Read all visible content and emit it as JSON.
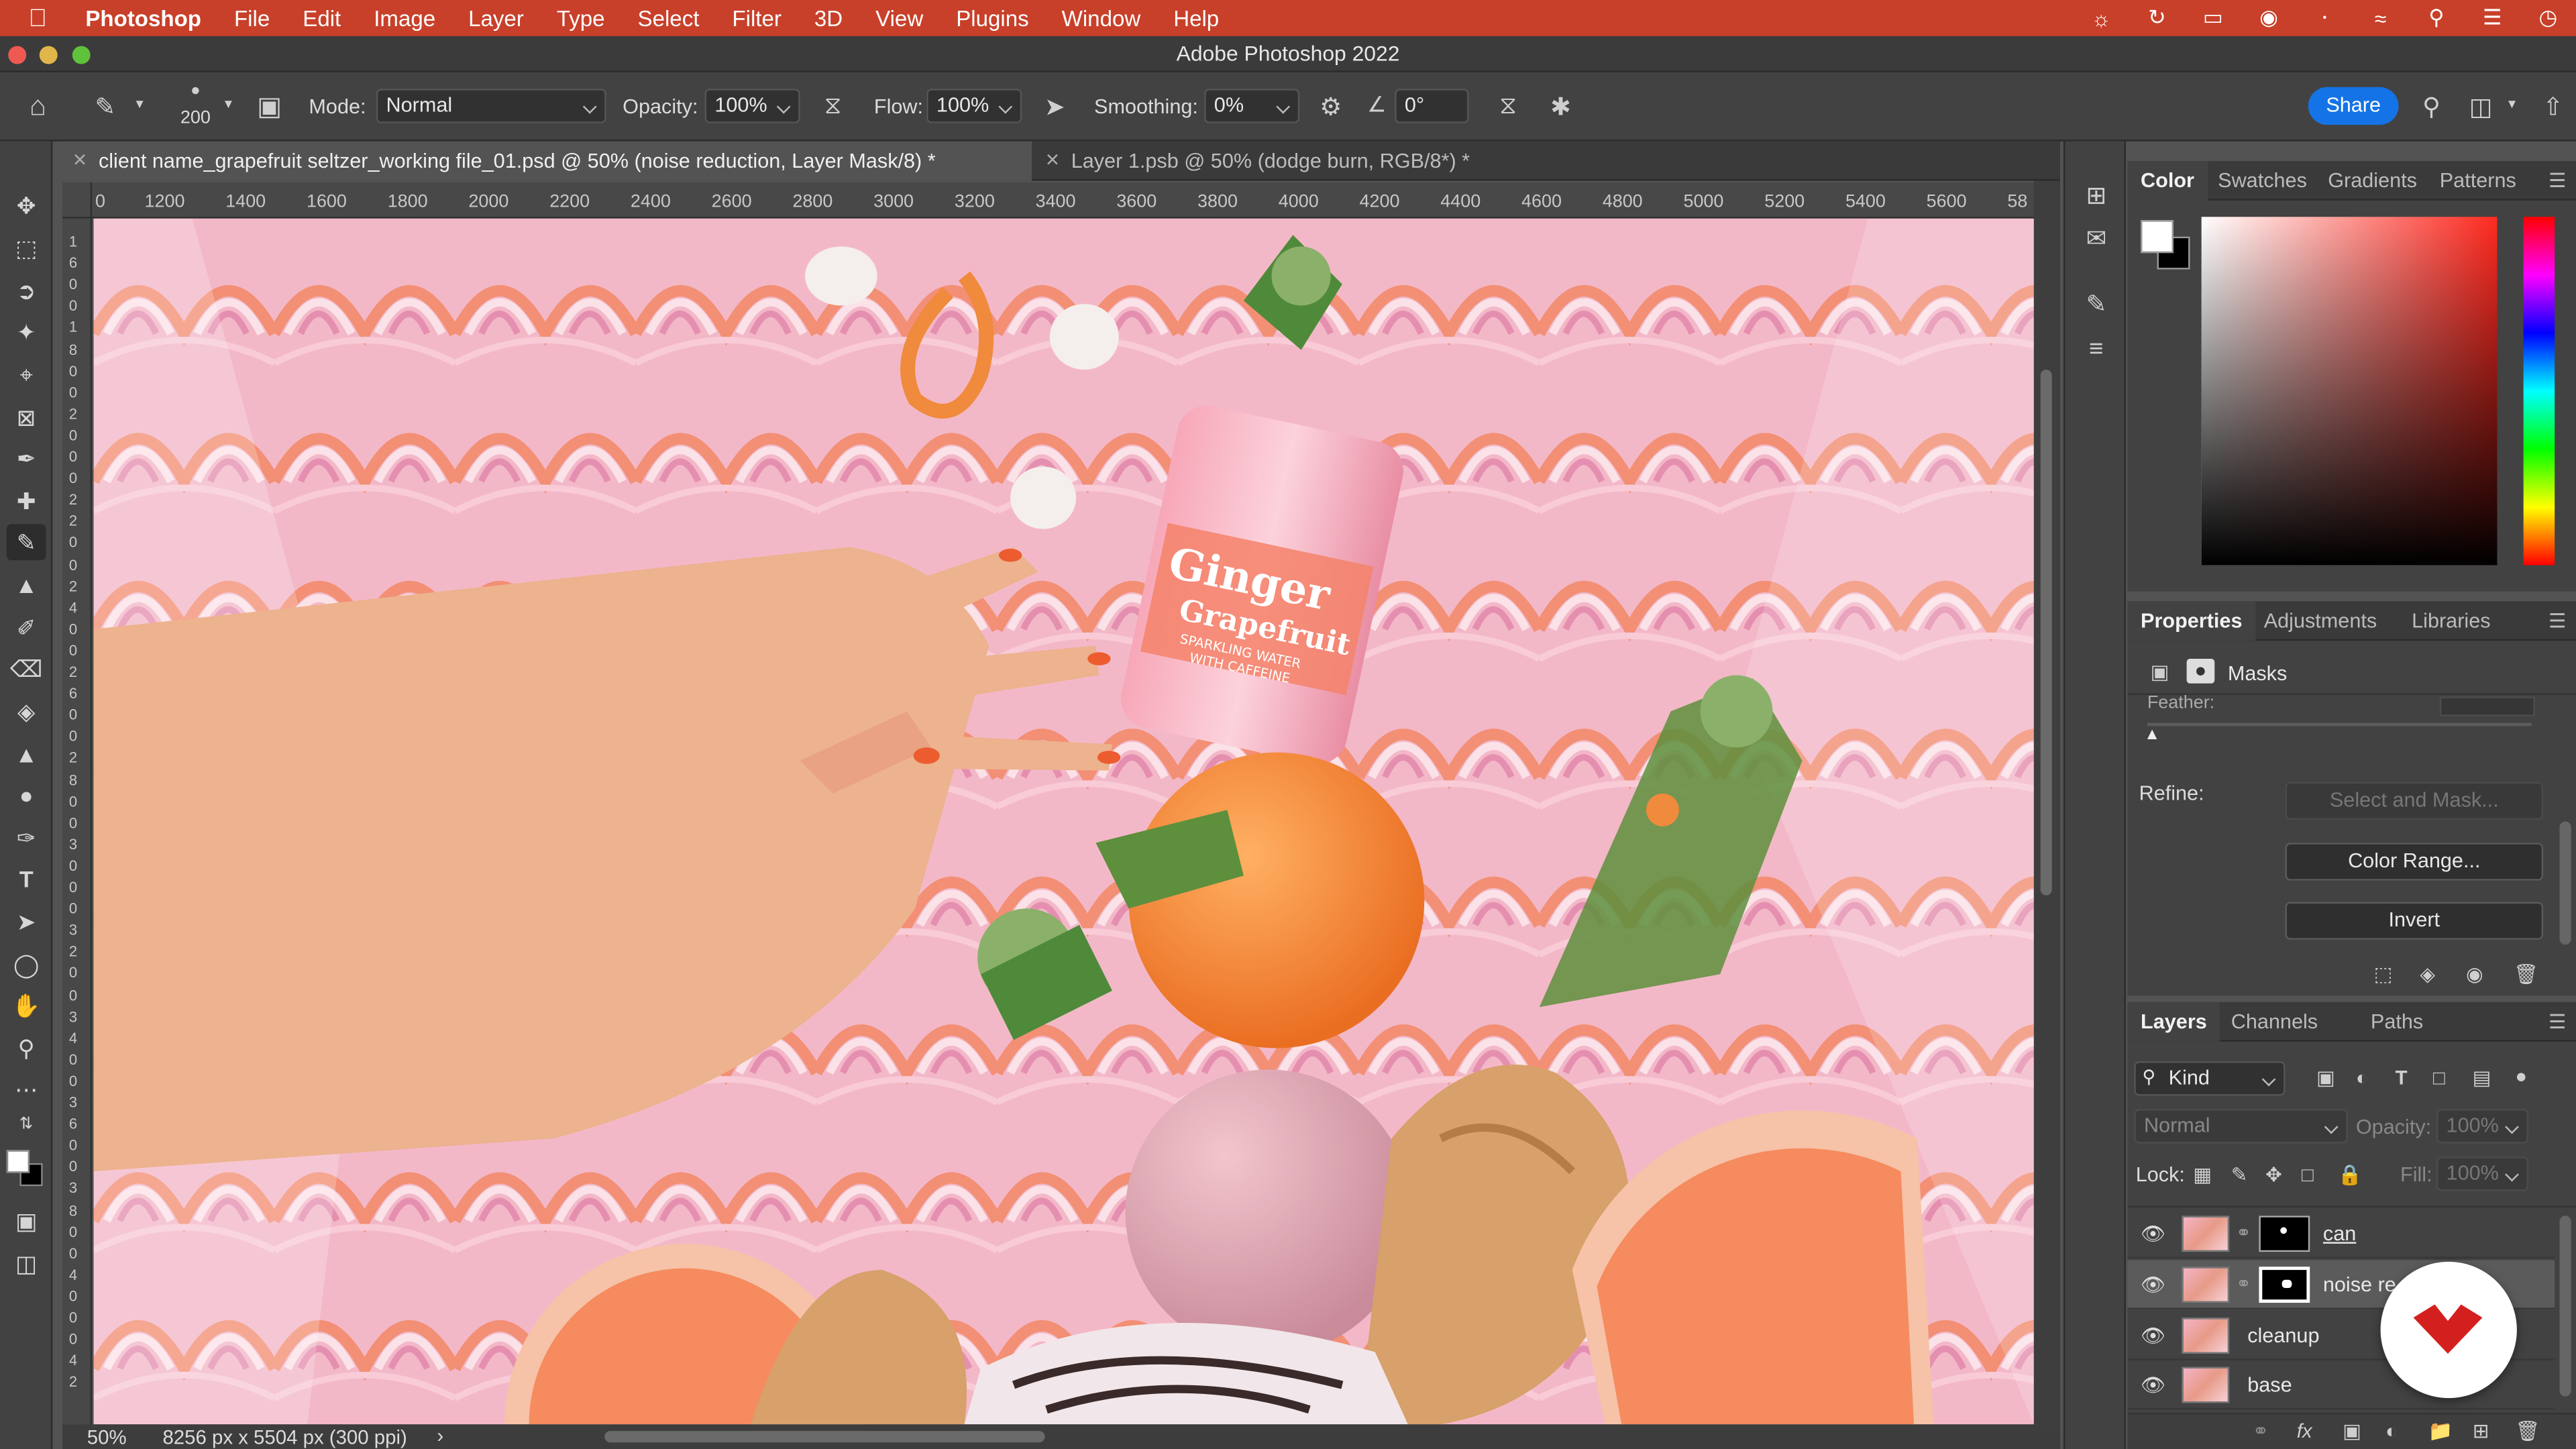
{
  "menubar": {
    "items": [
      "Photoshop",
      "File",
      "Edit",
      "Image",
      "Layer",
      "Type",
      "Select",
      "Filter",
      "3D",
      "View",
      "Plugins",
      "Window",
      "Help"
    ],
    "status_icons": [
      "creative-cloud-icon",
      "sync-icon",
      "display-icon",
      "record-icon",
      "bluetooth-icon",
      "wifi-icon",
      "spotlight-icon",
      "control-center-icon",
      "clock-icon"
    ]
  },
  "window": {
    "title": "Adobe Photoshop 2022"
  },
  "options": {
    "brush_size": "200",
    "mode_label": "Mode:",
    "mode_value": "Normal",
    "opacity_label": "Opacity:",
    "opacity_value": "100%",
    "flow_label": "Flow:",
    "flow_value": "100%",
    "smoothing_label": "Smoothing:",
    "smoothing_value": "0%",
    "angle_value": "0°",
    "share_label": "Share"
  },
  "tabs": [
    {
      "label": "client name_grapefruit seltzer_working file_01.psd @ 50% (noise reduction, Layer Mask/8) *",
      "active": true
    },
    {
      "label": "Layer 1.psb @ 50% (dodge burn, RGB/8*) *",
      "active": false
    }
  ],
  "ruler": {
    "h_ticks": [
      "0",
      "1200",
      "1400",
      "1600",
      "1800",
      "2000",
      "2200",
      "2400",
      "2600",
      "2800",
      "3000",
      "3200",
      "3400",
      "3600",
      "3800",
      "4000",
      "4200",
      "4400",
      "4600",
      "4800",
      "5000",
      "5200",
      "5400",
      "5600",
      "58"
    ],
    "v_ticks": [
      "1",
      "6",
      "0",
      "0",
      "1",
      "8",
      "0",
      "0",
      "2",
      "0",
      "0",
      "0",
      "2",
      "2",
      "0",
      "0",
      "2",
      "4",
      "0",
      "0",
      "2",
      "6",
      "0",
      "0",
      "2",
      "8",
      "0",
      "0",
      "3",
      "0",
      "0",
      "0",
      "3",
      "2",
      "0",
      "0",
      "3",
      "4",
      "0",
      "0",
      "3",
      "6",
      "0",
      "0",
      "3",
      "8",
      "0",
      "0",
      "4",
      "0",
      "0",
      "0",
      "4",
      "2"
    ]
  },
  "can_text": {
    "line1": "Ginger",
    "line2": "Grapefruit",
    "line3": "SPARKLING WATER",
    "line4": "WITH CAFFEINE"
  },
  "status": {
    "zoom": "50%",
    "dimensions": "8256 px x 5504 px (300 ppi)",
    "arrow": "›"
  },
  "color_panel": {
    "tabs": [
      "Color",
      "Swatches",
      "Gradients",
      "Patterns"
    ],
    "foreground": "#ffffff",
    "background": "#000000",
    "hue": "#ff2a20"
  },
  "properties_panel": {
    "tabs": [
      "Properties",
      "Adjustments",
      "Libraries"
    ],
    "section": "Masks",
    "feather_label": "Feather:",
    "refine_label": "Refine:",
    "select_mask_label": "Select and Mask...",
    "color_range_label": "Color Range...",
    "invert_label": "Invert"
  },
  "layers_panel": {
    "tabs": [
      "Layers",
      "Channels",
      "Paths"
    ],
    "filter_label": "Kind",
    "blend_mode": "Normal",
    "opacity_label": "Opacity:",
    "opacity_value": "100%",
    "lock_label": "Lock:",
    "fill_label": "Fill:",
    "fill_value": "100%",
    "layers": [
      {
        "name": "can",
        "has_mask": true,
        "selected": false
      },
      {
        "name": "noise re",
        "has_mask": true,
        "selected": true
      },
      {
        "name": "cleanup",
        "has_mask": false,
        "selected": false
      },
      {
        "name": "base",
        "has_mask": false,
        "selected": false
      }
    ]
  }
}
